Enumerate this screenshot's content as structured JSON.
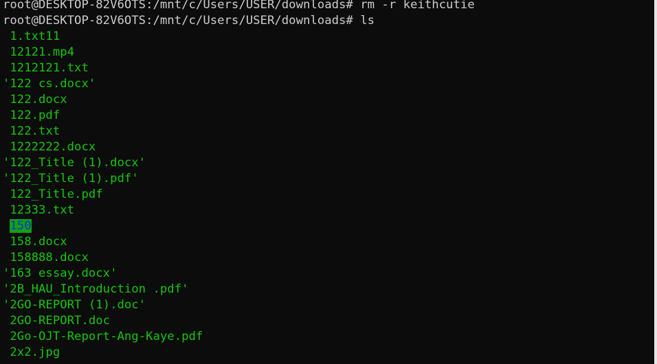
{
  "terminal": {
    "colors": {
      "background": "#0c0c0c",
      "foreground": "#cccccc",
      "file": "#16c60c",
      "dir_highlight_bg": "#16a00c",
      "dir_highlight_fg": "#0037da"
    },
    "commands": [
      "root@DESKTOP-82V6OTS:/mnt/c/Users/USER/downloads# rm -r keithcutie",
      "root@DESKTOP-82V6OTS:/mnt/c/Users/USER/downloads# ls"
    ],
    "entries": [
      {
        "prefix": " ",
        "name": "1.txt11"
      },
      {
        "prefix": " ",
        "name": "12121.mp4"
      },
      {
        "prefix": " ",
        "name": "1212121.txt"
      },
      {
        "prefix": "",
        "name": "'122 cs.docx'"
      },
      {
        "prefix": " ",
        "name": "122.docx"
      },
      {
        "prefix": " ",
        "name": "122.pdf"
      },
      {
        "prefix": " ",
        "name": "122.txt"
      },
      {
        "prefix": " ",
        "name": "1222222.docx"
      },
      {
        "prefix": "",
        "name": "'122_Title (1).docx'"
      },
      {
        "prefix": "",
        "name": "'122_Title (1).pdf'"
      },
      {
        "prefix": " ",
        "name": "122_Title.pdf"
      },
      {
        "prefix": " ",
        "name": "12333.txt"
      },
      {
        "prefix": " ",
        "name": "150",
        "highlight": true
      },
      {
        "prefix": " ",
        "name": "158.docx"
      },
      {
        "prefix": " ",
        "name": "158888.docx"
      },
      {
        "prefix": "",
        "name": "'163 essay.docx'"
      },
      {
        "prefix": "",
        "name": "'2B_HAU_Introduction .pdf'"
      },
      {
        "prefix": "",
        "name": "'2GO-REPORT (1).doc'"
      },
      {
        "prefix": " ",
        "name": "2GO-REPORT.doc"
      },
      {
        "prefix": " ",
        "name": "2Go-OJT-Report-Ang-Kaye.pdf"
      },
      {
        "prefix": " ",
        "name": "2x2.jpg"
      }
    ]
  }
}
